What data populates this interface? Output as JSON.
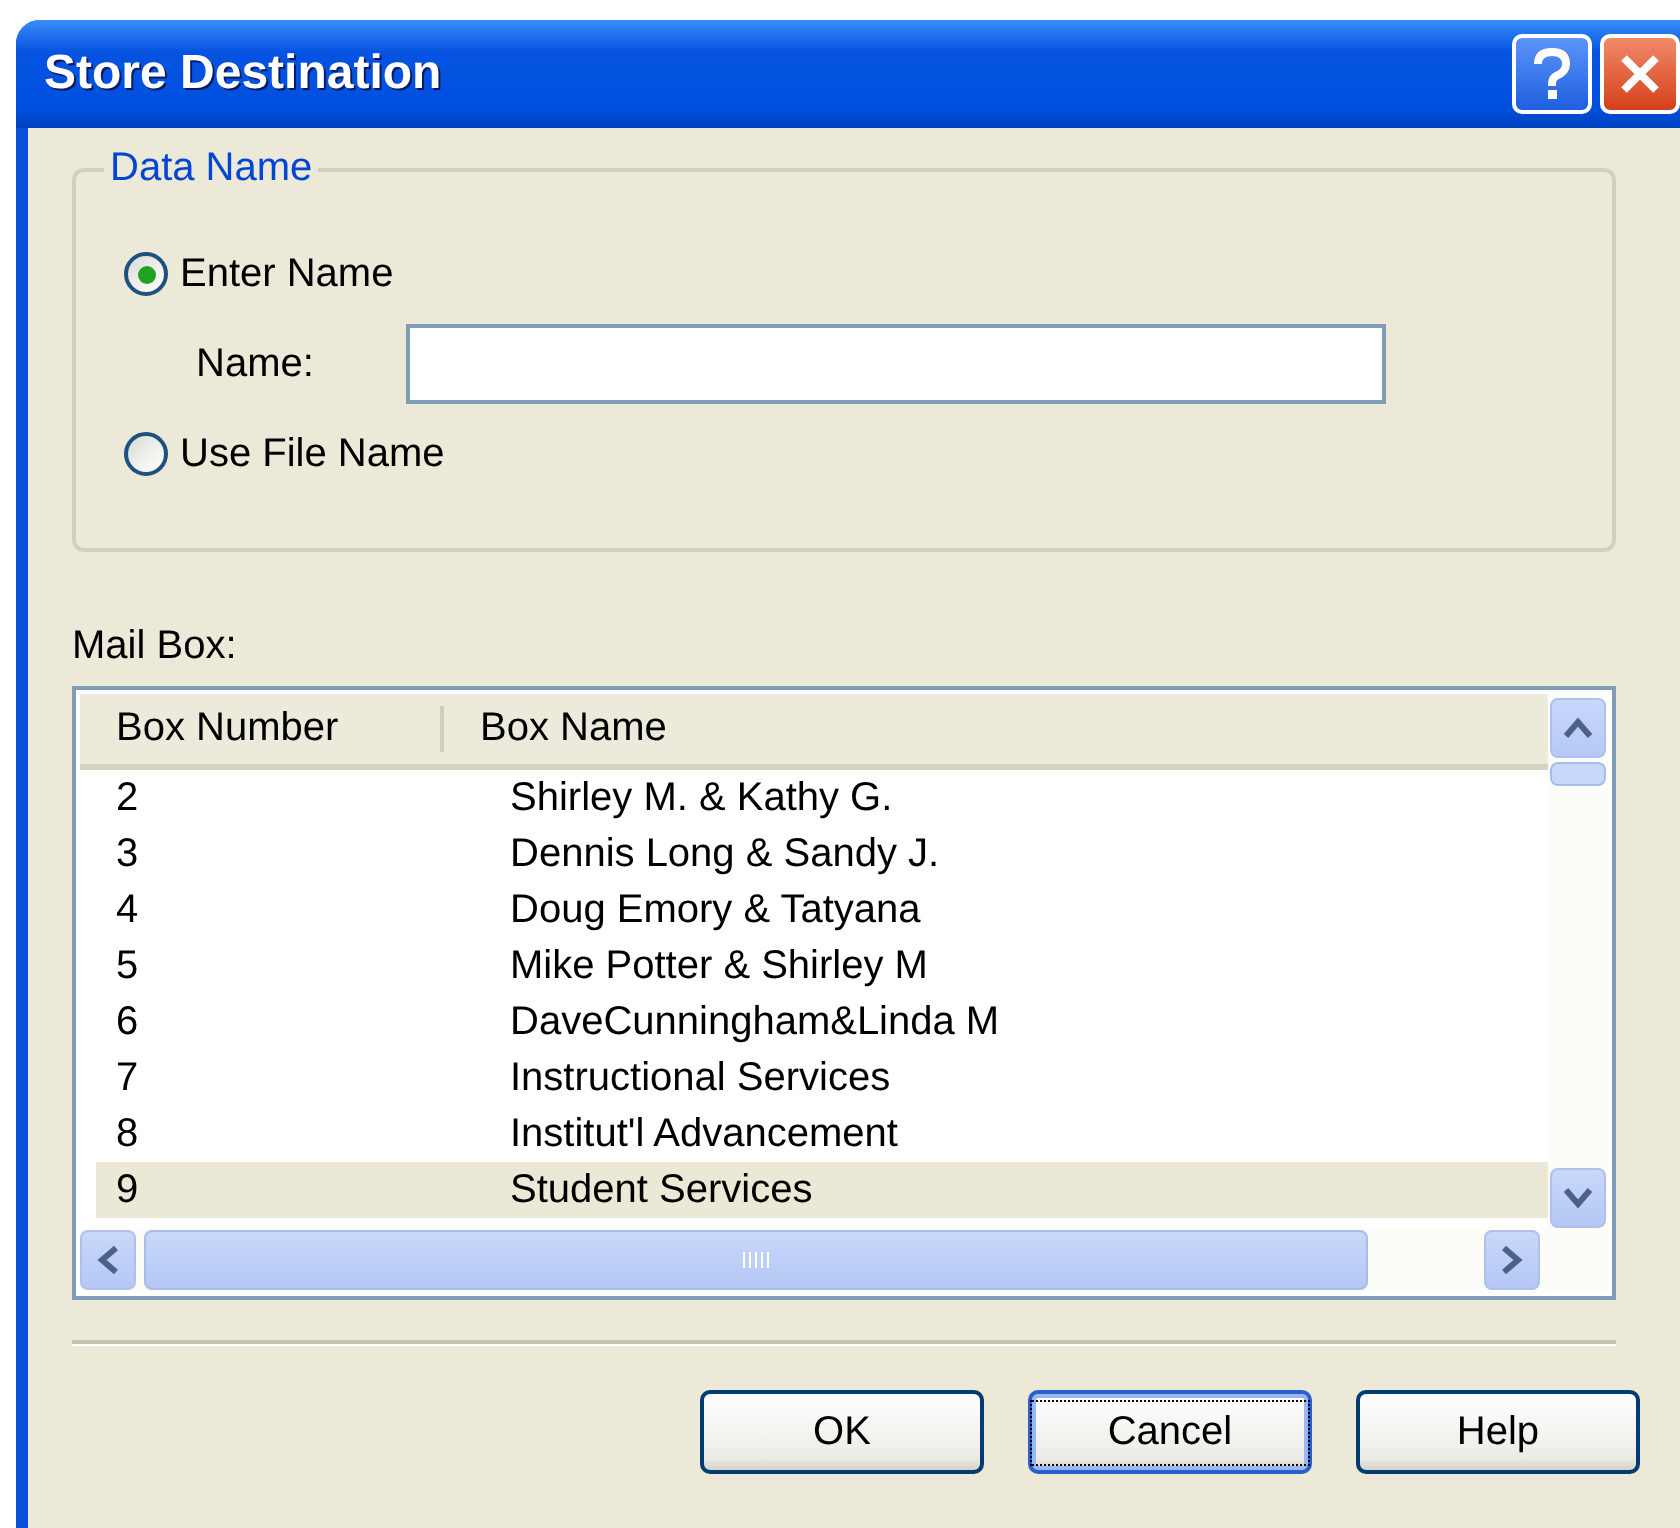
{
  "window": {
    "title": "Store Destination"
  },
  "group": {
    "legend": "Data Name",
    "options": [
      {
        "label": "Enter Name",
        "selected": true
      },
      {
        "label": "Use File Name",
        "selected": false
      }
    ],
    "name_field": {
      "label": "Name:"
    }
  },
  "mailbox": {
    "label": "Mail Box:",
    "columns": [
      "Box Number",
      "Box Name"
    ],
    "rows": [
      {
        "number": "2",
        "name": "Shirley M. & Kathy G.",
        "selected": false
      },
      {
        "number": "3",
        "name": "Dennis Long & Sandy J.",
        "selected": false
      },
      {
        "number": "4",
        "name": "Doug Emory & Tatyana",
        "selected": false
      },
      {
        "number": "5",
        "name": "Mike Potter & Shirley M",
        "selected": false
      },
      {
        "number": "6",
        "name": "DaveCunningham&Linda M",
        "selected": false
      },
      {
        "number": "7",
        "name": "Instructional Services",
        "selected": false
      },
      {
        "number": "8",
        "name": "Institut'l Advancement",
        "selected": false
      },
      {
        "number": "9",
        "name": "Student Services",
        "selected": true
      }
    ]
  },
  "buttons": [
    {
      "label": "OK",
      "focused": false
    },
    {
      "label": "Cancel",
      "focused": true
    },
    {
      "label": "Help",
      "focused": false
    }
  ]
}
